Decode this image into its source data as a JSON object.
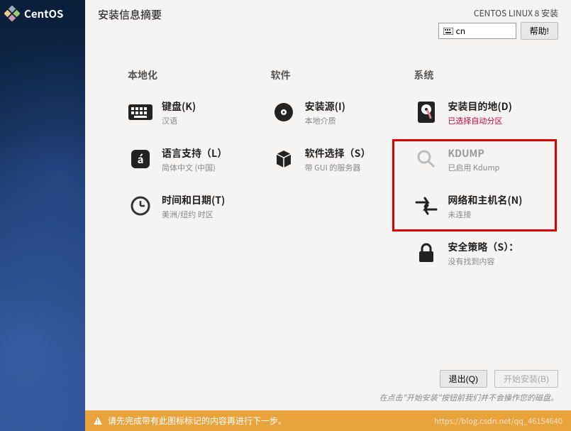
{
  "logo": {
    "text": "CentOS"
  },
  "header": {
    "title": "安装信息摘要",
    "product": "CENTOS LINUX 8 安装",
    "lang_code": "cn",
    "help_label": "帮助!"
  },
  "columns": {
    "local": {
      "heading": "本地化",
      "items": [
        {
          "icon": "keyboard",
          "title": "键盘(K)",
          "sub": "汉语"
        },
        {
          "icon": "lang",
          "title": "语言支持（L）",
          "sub": "简体中文 (中国)"
        },
        {
          "icon": "time",
          "title": "时间和日期(T)",
          "sub": "美洲/纽约 时区"
        }
      ]
    },
    "software": {
      "heading": "软件",
      "items": [
        {
          "icon": "source",
          "title": "安装源(I)",
          "sub": "本地介质"
        },
        {
          "icon": "selection",
          "title": "软件选择（S）",
          "sub": "带 GUI 的服务器"
        }
      ]
    },
    "system": {
      "heading": "系统",
      "items": [
        {
          "icon": "dest",
          "title": "安装目的地(D)",
          "sub": "已选择自动分区",
          "warn": true
        },
        {
          "icon": "kdump",
          "title": "KDUMP",
          "sub": "已启用 Kdump",
          "dim": true
        },
        {
          "icon": "network",
          "title": "网络和主机名(N)",
          "sub": "未连接"
        },
        {
          "icon": "security",
          "title": "安全策略（S）：",
          "sub": "没有找到内容"
        }
      ]
    }
  },
  "footer": {
    "quit_label": "退出(Q)",
    "begin_label": "开始安装(B)",
    "hint": "在点击\"开始安装\"按钮前我们并不会操作您的磁盘。"
  },
  "warning_bar": {
    "text": "请先完成带有此图标标记的内容再进行下一步。",
    "watermark": "https://blog.csdn.net/qq_46154640"
  }
}
